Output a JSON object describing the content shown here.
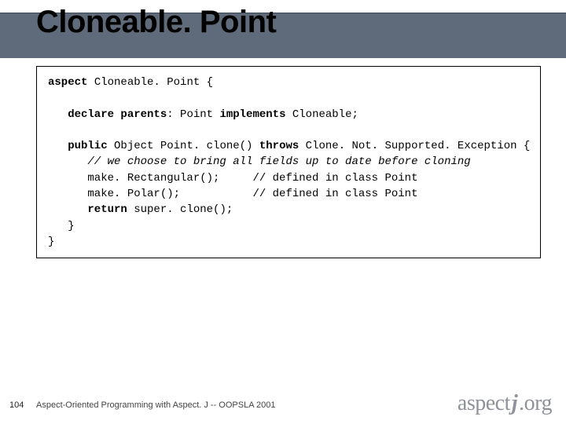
{
  "slide": {
    "title": "Cloneable. Point",
    "code": {
      "l1a": "aspect",
      "l1b": " Cloneable. Point {",
      "blank1": "",
      "l2a": "   declare parents",
      "l2b": ": Point ",
      "l2c": "implements",
      "l2d": " Cloneable;",
      "blank2": "",
      "l3a": "   public",
      "l3b": " Object Point. clone() ",
      "l3c": "throws",
      "l3d": " Clone. Not. Supported. Exception {",
      "l4": "      // we choose to bring all fields up to date before cloning",
      "l5": "      make. Rectangular();     // defined in class Point",
      "l6": "      make. Polar();           // defined in class Point",
      "l7a": "      return",
      "l7b": " super. clone();",
      "l8": "   }",
      "l9": "}"
    }
  },
  "footer": {
    "page": "104",
    "text": "Aspect-Oriented Programming with Aspect. J -- OOPSLA 2001",
    "logo_left": "aspect",
    "logo_j": "j",
    "logo_right": ".org"
  }
}
